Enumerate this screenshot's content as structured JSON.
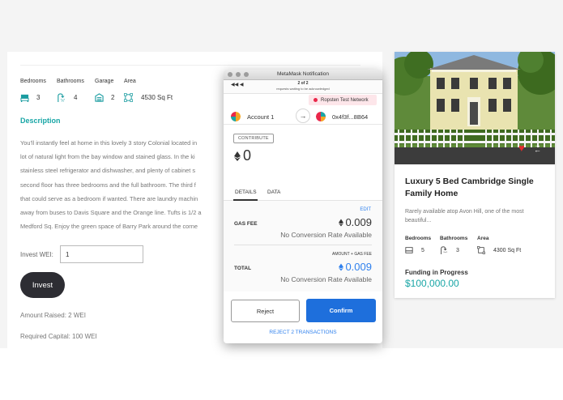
{
  "listing": {
    "spec_labels": {
      "bedrooms": "Bedrooms",
      "bathrooms": "Bathrooms",
      "garage": "Garage",
      "area": "Area"
    },
    "spec_values": {
      "bedrooms": "3",
      "bathrooms": "4",
      "garage": "2",
      "area": "4530 Sq Ft"
    },
    "description_title": "Description",
    "description_lines": [
      "You'll instantly feel at home in this lovely 3 story Colonial located in",
      "lot of natural light from the bay window and stained glass. In the ki",
      "stainless steel refrigerator and dishwasher, and plenty of cabinet s",
      "second floor has three bedrooms and the full bathroom. The third f",
      "that could serve as a bedroom if wanted. There are laundry machin",
      "away from buses to Davis Square and the Orange line. Tufts is 1/2 a",
      "Medford Sq. Enjoy the green space of Barry Park around the corne"
    ],
    "invest_label": "Invest WEI:",
    "invest_value": "1",
    "invest_button": "Invest",
    "amount_raised": "Amount Raised: 2 WEI",
    "required_capital": "Required Capital: 100 WEI"
  },
  "card": {
    "title": "Luxury 5 Bed Cambridge Single Family Home",
    "subtitle": "Rarely available atop Avon Hill, one of the most beautiful...",
    "spec_labels": {
      "bedrooms": "Bedrooms",
      "bathrooms": "Bathrooms",
      "area": "Area"
    },
    "spec_values": {
      "bedrooms": "5",
      "bathrooms": "3",
      "area": "4300 Sq Ft"
    },
    "funding_label": "Funding in Progress",
    "funding_value": "$100,000.00",
    "icons": [
      "heart-icon",
      "swap-arrows-icon"
    ],
    "heart_color": "#e32b2b"
  },
  "metamask": {
    "window_title": "MetaMask Notification",
    "tx_counter": "2 of 2",
    "tx_counter_sub": "requests waiting to be acknowledged",
    "network": "Ropsten Test Network",
    "from_account": "Account 1",
    "to_address": "0x4f3f...8B64",
    "method": "CONTRIBUTE",
    "amount": "0",
    "tabs": [
      "DETAILS",
      "DATA"
    ],
    "active_tab": "DETAILS",
    "edit_label": "EDIT",
    "gas_fee_label": "GAS FEE",
    "gas_fee_value": "0.009",
    "gas_fee_conversion": "No Conversion Rate Available",
    "amount_plus_gas_label": "AMOUNT + GAS FEE",
    "total_label": "TOTAL",
    "total_value": "0.009",
    "total_conversion": "No Conversion Rate Available",
    "reject_label": "Reject",
    "confirm_label": "Confirm",
    "reject_all_label": "REJECT 2 TRANSACTIONS",
    "accent_color": "#2f80ed",
    "confirm_color": "#1e6fdc",
    "network_dot_color": "#e9274a"
  },
  "colors": {
    "teal_accent": "#19a6a6",
    "dark_button": "#2d2d33"
  }
}
